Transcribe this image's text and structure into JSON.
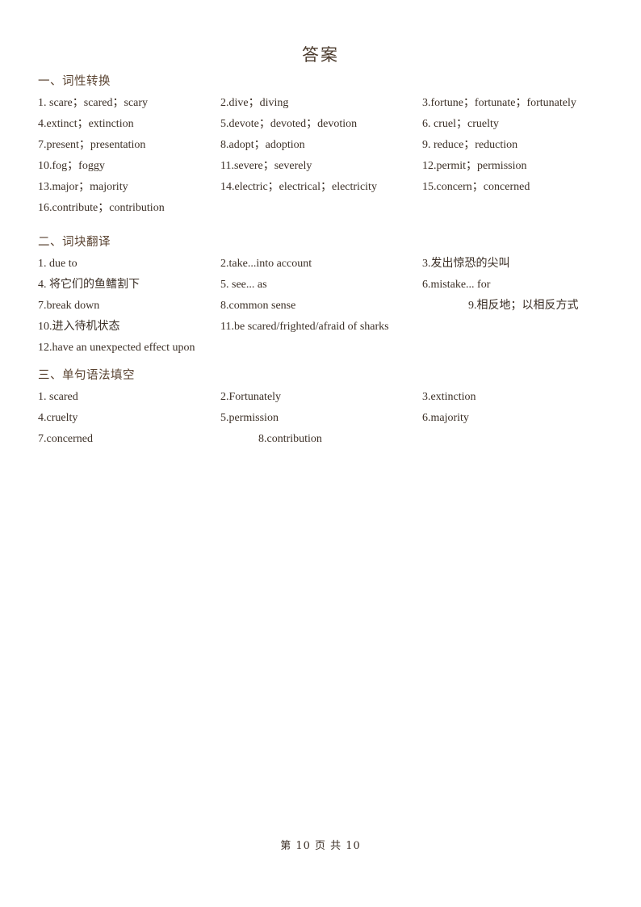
{
  "document": {
    "title": "答案",
    "footer": "第 10 页 共 10"
  },
  "sections": [
    {
      "heading": "一、词性转换",
      "rows": [
        {
          "col1": "1. scare；scared；scary",
          "col2": "2.dive；diving",
          "col3": "3.fortune；fortunate；fortunately"
        },
        {
          "col1": "4.extinct；extinction",
          "col2": "5.devote；devoted；devotion",
          "col3": "6. cruel；cruelty"
        },
        {
          "col1": "7.present；presentation",
          "col2": "8.adopt；adoption",
          "col3": "9. reduce；reduction"
        },
        {
          "col1": "10.fog；foggy",
          "col2": "11.severe；severely",
          "col3": "12.permit；permission"
        },
        {
          "col1": "13.major；majority",
          "col2": "14.electric；electrical；electricity",
          "col3": "15.concern；concerned"
        },
        {
          "col1": "16.contribute；contribution",
          "col2": "",
          "col3": ""
        }
      ]
    },
    {
      "heading": "二、词块翻译",
      "rows": [
        {
          "col1": "1. due to",
          "col2": "2.take...into account",
          "col3": "3.发出惊恐的尖叫"
        },
        {
          "col1": "4. 将它们的鱼鳍割下",
          "col2": "5. see... as",
          "col3": "6.mistake... for"
        },
        {
          "col1": "7.break down",
          "col2": "8.common sense",
          "col3": "9.相反地；以相反方式"
        },
        {
          "col1": "10.进入待机状态",
          "col2": "11.be scared/frighted/afraid of sharks",
          "col3": ""
        },
        {
          "col1": "12.have an unexpected effect upon",
          "col2": "",
          "col3": ""
        }
      ]
    },
    {
      "heading": "三、单句语法填空",
      "rows": [
        {
          "col1": "1. scared",
          "col2": "2.Fortunately",
          "col3": "3.extinction"
        },
        {
          "col1": "4.cruelty",
          "col2": "5.permission",
          "col3": "6.majority"
        },
        {
          "col1": "7.concerned",
          "col2": "8.contribution",
          "col3": ""
        }
      ]
    }
  ]
}
